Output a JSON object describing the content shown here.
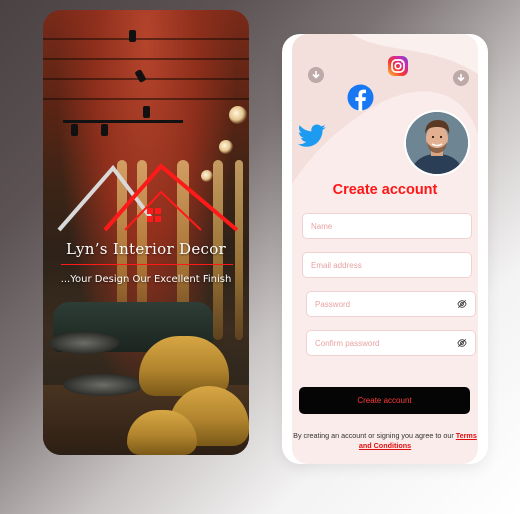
{
  "splash": {
    "brand_name": "Lyn’s Interior Decor",
    "tagline": "...Your Design Our Excellent Finish"
  },
  "signup": {
    "heading": "Create account",
    "fields": {
      "name_placeholder": "Name",
      "email_placeholder": "Email address",
      "password_placeholder": "Password",
      "confirm_password_placeholder": "Confirm password"
    },
    "submit_label": "Create account",
    "terms_prefix": "By creating an account or signing you agree to our",
    "terms_link": "Terms and Conditions",
    "social_icons": [
      "instagram-icon",
      "facebook-icon",
      "twitter-icon"
    ]
  },
  "colors": {
    "accent_red": "#ff1616",
    "card_bg": "#f9ecea",
    "button_bg": "#050505",
    "twitter_blue": "#1d9bf0",
    "facebook_blue": "#1877f2"
  }
}
